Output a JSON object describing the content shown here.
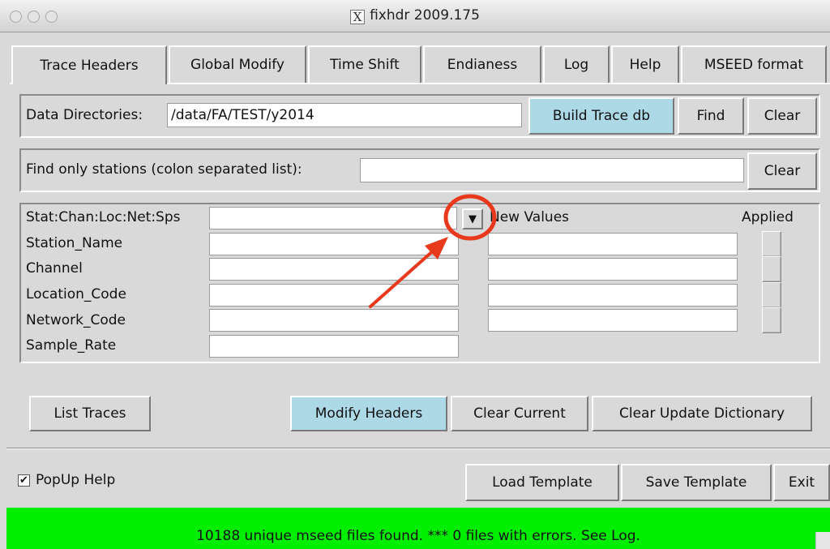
{
  "window": {
    "title": "fixhdr 2009.175"
  },
  "tabs": [
    {
      "label": "Trace Headers",
      "active": true
    },
    {
      "label": "Global Modify"
    },
    {
      "label": "Time Shift"
    },
    {
      "label": "Endianess"
    },
    {
      "label": "Log"
    },
    {
      "label": "Help"
    },
    {
      "label": "MSEED format"
    }
  ],
  "data_dirs": {
    "label": "Data Directories:",
    "value": "/data/FA/TEST/y2014",
    "build_label": "Build Trace db",
    "find_label": "Find",
    "clear_label": "Clear"
  },
  "find_stations": {
    "label": "Find only stations (colon separated list):",
    "value": "",
    "clear_label": "Clear"
  },
  "header_fields": {
    "selector_label": "Stat:Chan:Loc:Net:Sps",
    "selector_value": "",
    "new_values_label": "New Values",
    "applied_label": "Applied",
    "rows": [
      {
        "label": "Station_Name",
        "current": "",
        "new": ""
      },
      {
        "label": "Channel",
        "current": "",
        "new": ""
      },
      {
        "label": "Location_Code",
        "current": "",
        "new": ""
      },
      {
        "label": "Network_Code",
        "current": "",
        "new": ""
      },
      {
        "label": "Sample_Rate",
        "current": ""
      }
    ]
  },
  "actions": {
    "list_traces": "List Traces",
    "modify_headers": "Modify Headers",
    "clear_current": "Clear Current",
    "clear_update_dictionary": "Clear Update Dictionary"
  },
  "footer": {
    "popup_help_label": "PopUp Help",
    "popup_help_checked": true,
    "load_template": "Load Template",
    "save_template": "Save Template",
    "exit": "Exit"
  },
  "status": {
    "message": "10188 unique mseed files found. *** 0 files with errors. See Log.",
    "color": "#00ee00"
  },
  "colors": {
    "accent_button": "#add8e6",
    "annotation": "#e8391d"
  }
}
